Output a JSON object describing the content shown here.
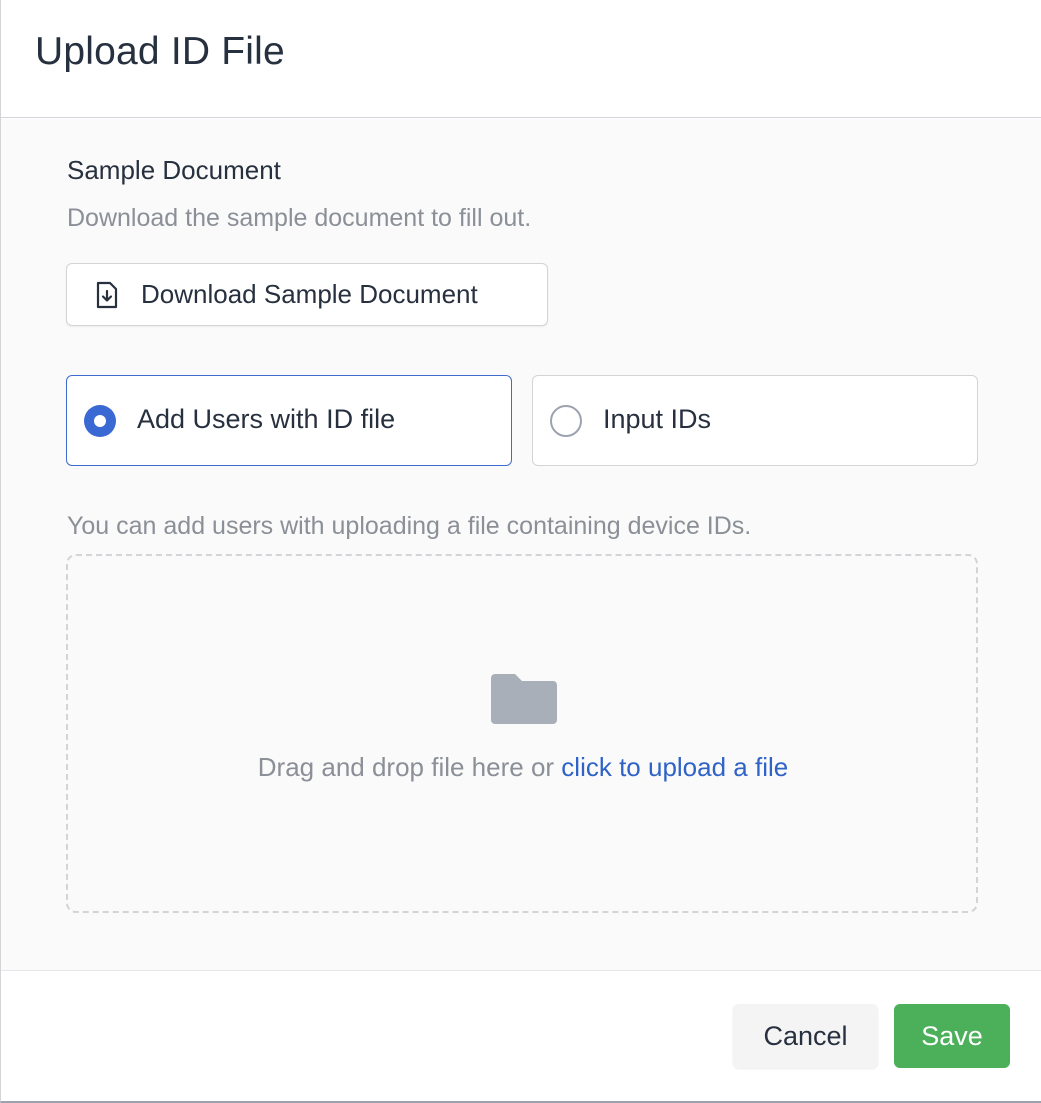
{
  "modal": {
    "title": "Upload ID File"
  },
  "sample": {
    "title": "Sample Document",
    "description": "Download the sample document to fill out.",
    "download_label": "Download Sample Document",
    "download_icon": "file-download-icon"
  },
  "mode": {
    "options": [
      {
        "label": "Add Users with ID file",
        "selected": true
      },
      {
        "label": "Input IDs",
        "selected": false
      }
    ],
    "accent_color": "#3a69d4"
  },
  "upload": {
    "hint": "You can add users with uploading a file containing device IDs.",
    "drop_text": "Drag and drop file here or ",
    "drop_link": "click to upload a file",
    "folder_icon": "folder-icon"
  },
  "footer": {
    "cancel_label": "Cancel",
    "save_label": "Save",
    "save_color": "#4caf5a"
  }
}
